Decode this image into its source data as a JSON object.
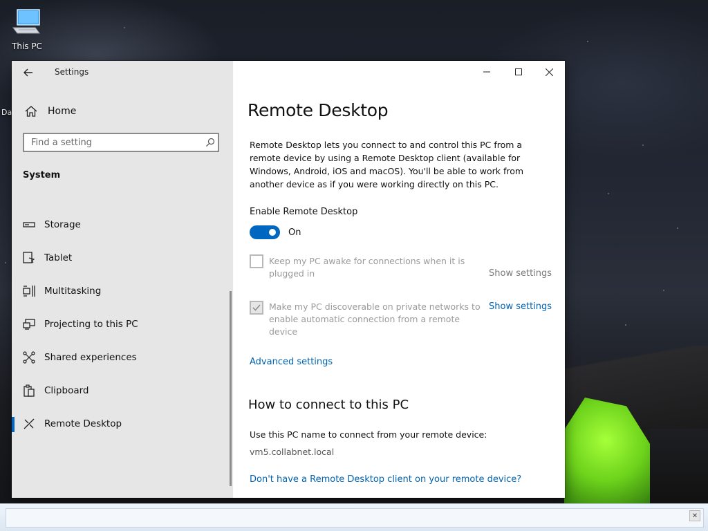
{
  "desktop": {
    "icon_label": "This PC",
    "icon_name": "this-pc-icon",
    "sliver_text": "Da"
  },
  "window": {
    "title": "Settings",
    "back_icon": "back-arrow-icon",
    "controls": [
      "minimize-icon",
      "maximize-icon",
      "close-icon"
    ]
  },
  "nav": {
    "home_label": "Home",
    "search_placeholder": "Find a setting",
    "section": "System",
    "items": [
      {
        "label": "Storage",
        "icon": "storage-icon"
      },
      {
        "label": "Tablet",
        "icon": "tablet-icon"
      },
      {
        "label": "Multitasking",
        "icon": "multitasking-icon"
      },
      {
        "label": "Projecting to this PC",
        "icon": "projecting-icon"
      },
      {
        "label": "Shared experiences",
        "icon": "shared-experiences-icon"
      },
      {
        "label": "Clipboard",
        "icon": "clipboard-icon"
      },
      {
        "label": "Remote Desktop",
        "icon": "remote-desktop-icon",
        "active": true
      }
    ]
  },
  "content": {
    "title": "Remote Desktop",
    "description": "Remote Desktop lets you connect to and control this PC from a remote device by using a Remote Desktop client (available for Windows, Android, iOS and macOS). You'll be able to work from another device as if you were working directly on this PC.",
    "enable_label": "Enable Remote Desktop",
    "toggle_state": "On",
    "option1": {
      "text": "Keep my PC awake for connections when it is plugged in",
      "checked": false,
      "link": "Show settings"
    },
    "option2": {
      "text": "Make my PC discoverable on private networks to enable automatic connection from a remote device",
      "checked": true,
      "link": "Show settings"
    },
    "advanced_link": "Advanced settings",
    "how_to_heading": "How to connect to this PC",
    "pc_name_text": "Use this PC name to connect from your remote device:",
    "pc_name": "vm5.collabnet.local",
    "client_link": "Don't have a Remote Desktop client on your remote device?"
  },
  "colors": {
    "accent": "#0067c0",
    "link": "#0063b1",
    "nav_bg": "#e6e6e6"
  }
}
